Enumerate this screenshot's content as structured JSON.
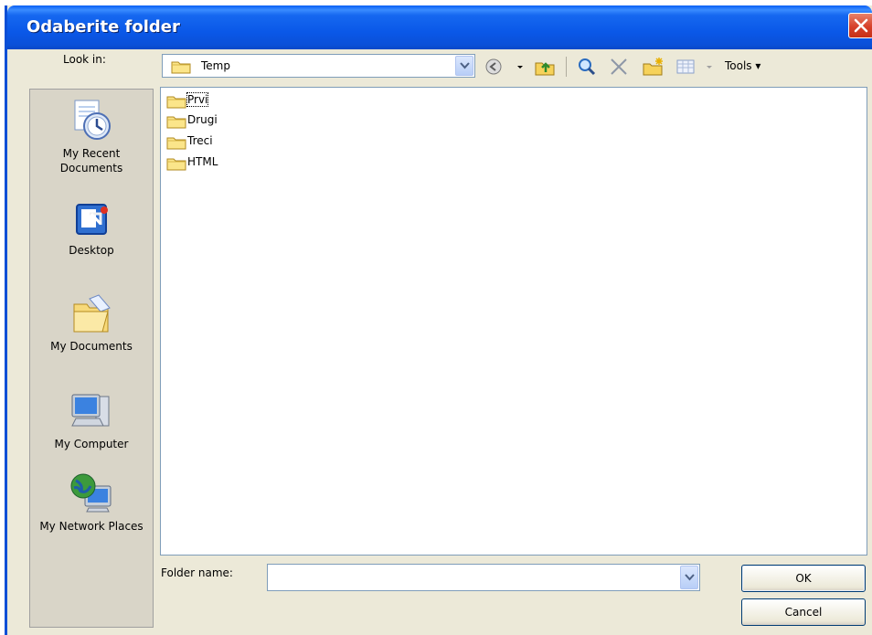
{
  "window": {
    "title": "Odaberite folder"
  },
  "lookin": {
    "label": "Look in:",
    "value": "Temp"
  },
  "toolbar": {
    "tools_label": "Tools"
  },
  "places": [
    {
      "label": "My Recent Documents",
      "icon": "recent-documents-icon"
    },
    {
      "label": "Desktop",
      "icon": "desktop-icon"
    },
    {
      "label": "My Documents",
      "icon": "my-documents-icon"
    },
    {
      "label": "My Computer",
      "icon": "my-computer-icon"
    },
    {
      "label": "My Network Places",
      "icon": "network-places-icon"
    }
  ],
  "files": [
    "Prvi",
    "Drugi",
    "Treci",
    "HTML"
  ],
  "foldername": {
    "label": "Folder name:",
    "value": ""
  },
  "buttons": {
    "ok": "OK",
    "cancel": "Cancel"
  }
}
